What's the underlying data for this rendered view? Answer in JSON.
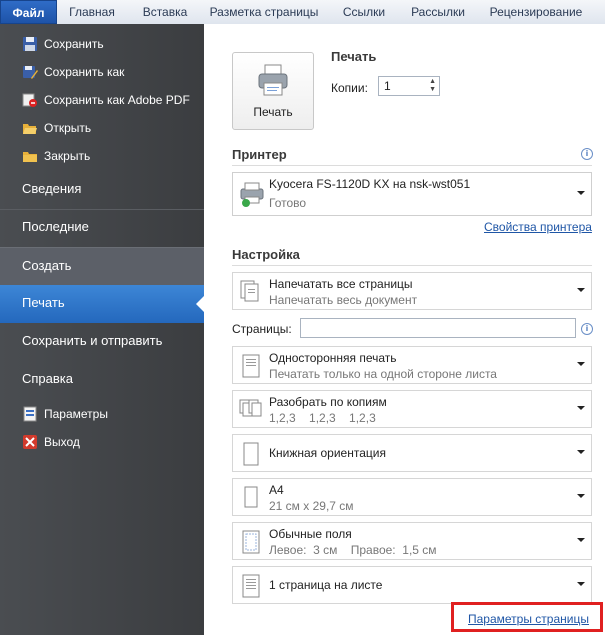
{
  "ribbon": {
    "tabs": [
      "Файл",
      "Главная",
      "Вставка",
      "Разметка страницы",
      "Ссылки",
      "Рассылки",
      "Рецензирование"
    ]
  },
  "sidebar": {
    "items": [
      {
        "label": "Сохранить",
        "icon": "save-icon"
      },
      {
        "label": "Сохранить как",
        "icon": "save-as-icon"
      },
      {
        "label": "Сохранить как Adobe PDF",
        "icon": "adobe-pdf-icon"
      },
      {
        "label": "Открыть",
        "icon": "open-folder-icon"
      },
      {
        "label": "Закрыть",
        "icon": "close-folder-icon"
      }
    ],
    "sections": [
      "Сведения",
      "Последние",
      "Создать",
      "Печать",
      "Сохранить и отправить",
      "Справка"
    ],
    "selected_section": "Печать",
    "bottom_items": [
      {
        "label": "Параметры",
        "icon": "options-icon"
      },
      {
        "label": "Выход",
        "icon": "exit-icon"
      }
    ]
  },
  "print": {
    "heading": "Печать",
    "button_label": "Печать",
    "copies_label": "Копии:",
    "copies_value": "1"
  },
  "printer": {
    "heading": "Принтер",
    "name": "Kyocera FS-1120D KX на nsk-wst051",
    "status": "Готово",
    "properties_link": "Свойства принтера"
  },
  "settings": {
    "heading": "Настройка",
    "pages_label": "Страницы:",
    "pages_value": "",
    "options": [
      {
        "title": "Напечатать все страницы",
        "subtitle": "Напечатать весь документ"
      },
      {
        "title": "Односторонняя печать",
        "subtitle": "Печатать только на одной стороне листа"
      },
      {
        "title": "Разобрать по копиям",
        "subtitle": "1,2,3    1,2,3    1,2,3"
      },
      {
        "title": "Книжная ориентация",
        "subtitle": ""
      },
      {
        "title": "A4",
        "subtitle": "21 см x 29,7 см"
      },
      {
        "title": "Обычные поля",
        "subtitle": "Левое:  3 см    Правое:  1,5 см"
      },
      {
        "title": "1 страница на листе",
        "subtitle": ""
      }
    ],
    "page_setup_link": "Параметры страницы"
  },
  "colors": {
    "accent": "#2468bd",
    "highlight_box": "#e02020"
  }
}
